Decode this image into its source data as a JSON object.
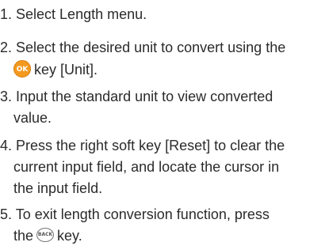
{
  "steps": [
    {
      "lines": [
        "1. Select Length menu."
      ]
    },
    {
      "lines": [
        "2. Select the desired unit to convert using the",
        "key [Unit]."
      ]
    },
    {
      "lines": [
        "3. Input the standard unit to view converted",
        "value."
      ]
    },
    {
      "lines": [
        "4. Press the right soft key [Reset] to clear the",
        "current input field, and locate the cursor in",
        "the input field."
      ]
    },
    {
      "lines": [
        "5. To exit length conversion function, press",
        "the",
        "key."
      ]
    }
  ],
  "icons": {
    "ok_key": {
      "label": "OK",
      "name": "ok-key-icon",
      "color": "#f39a1e"
    },
    "back_key": {
      "label": "BACK",
      "name": "back-key-icon",
      "color": "#777777"
    }
  }
}
